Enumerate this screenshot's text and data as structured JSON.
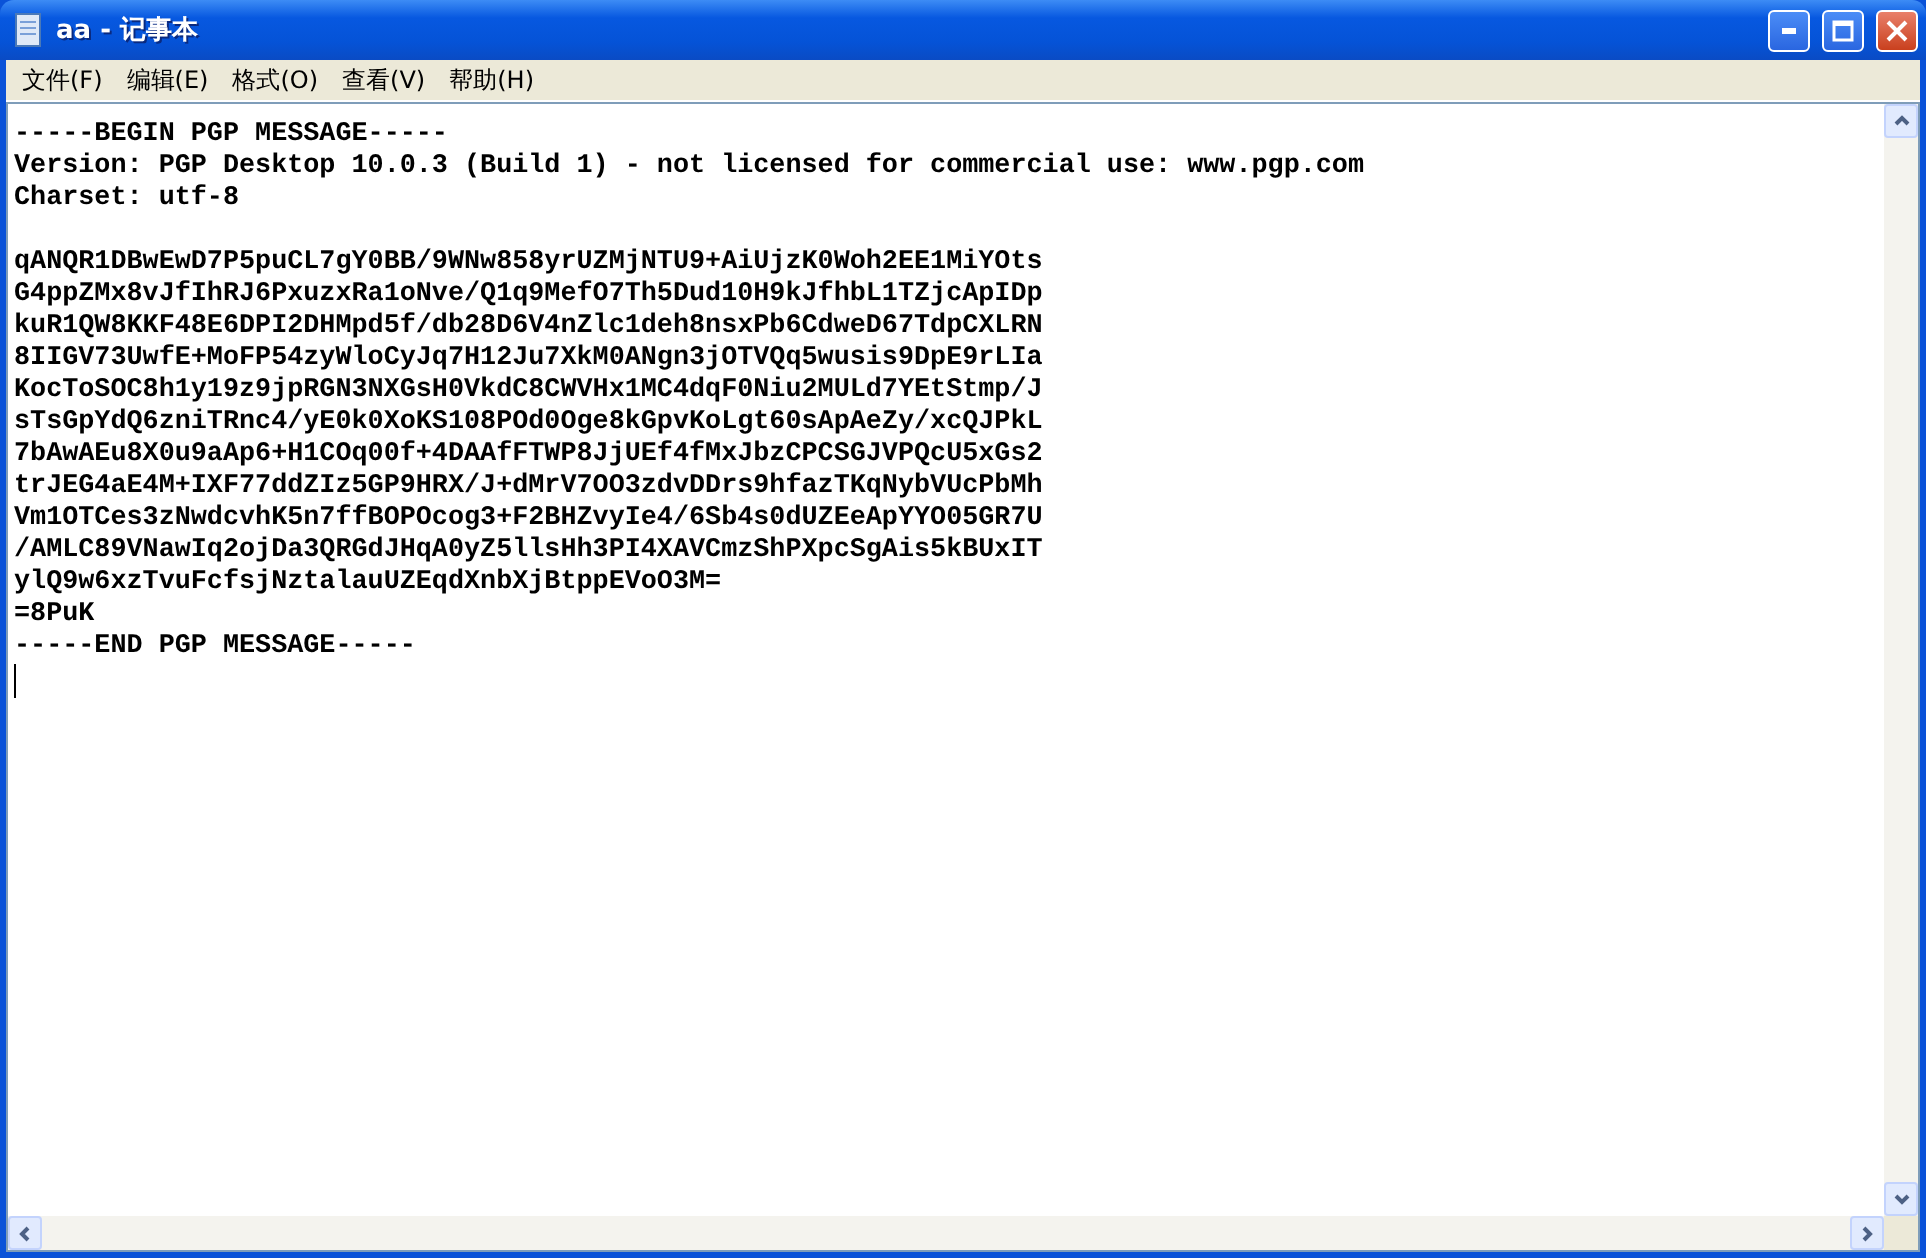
{
  "window": {
    "title": "aa - 记事本"
  },
  "menu": [
    {
      "label": "文件(F)"
    },
    {
      "label": "编辑(E)"
    },
    {
      "label": "格式(O)"
    },
    {
      "label": "查看(V)"
    },
    {
      "label": "帮助(H)"
    }
  ],
  "document": {
    "text": "-----BEGIN PGP MESSAGE-----\nVersion: PGP Desktop 10.0.3 (Build 1) - not licensed for commercial use: www.pgp.com\nCharset: utf-8\n\nqANQR1DBwEwD7P5puCL7gY0BB/9WNw858yrUZMjNTU9+AiUjzK0Woh2EE1MiYOts\nG4ppZMx8vJfIhRJ6PxuzxRa1oNve/Q1q9MefO7Th5Dud10H9kJfhbL1TZjcApIDp\nkuR1QW8KKF48E6DPI2DHMpd5f/db28D6V4nZlc1deh8nsxPb6CdweD67TdpCXLRN\n8IIGV73UwfE+MoFP54zyWloCyJq7H12Ju7XkM0ANgn3jOTVQq5wusis9DpE9rLIa\nKocToSOC8h1y19z9jpRGN3NXGsH0VkdC8CWVHx1MC4dqF0Niu2MULd7YEtStmp/J\nsTsGpYdQ6zniTRnc4/yE0k0XoKS108POd0Oge8kGpvKoLgt60sApAeZy/xcQJPkL\n7bAwAEu8X0u9aAp6+H1COq00f+4DAAfFTWP8JjUEf4fMxJbzCPCSGJVPQcU5xGs2\ntrJEG4aE4M+IXF77ddZIz5GP9HRX/J+dMrV7OO3zdvDDrs9hfazTKqNybVUcPbMh\nVm1OTCes3zNwdcvhK5n7ffBOPOcog3+F2BHZvyIe4/6Sb4s0dUZEeApYYO05GR7U\n/AMLC89VNawIq2ojDa3QRGdJHqA0yZ5llsHh3PI4XAVCmzShPXpcSgAis5kBUxIT\nylQ9w6xzTvuFcfsjNztalauUZEqdXnbXjBtppEVoO3M=\n=8PuK\n-----END PGP MESSAGE-----"
  }
}
